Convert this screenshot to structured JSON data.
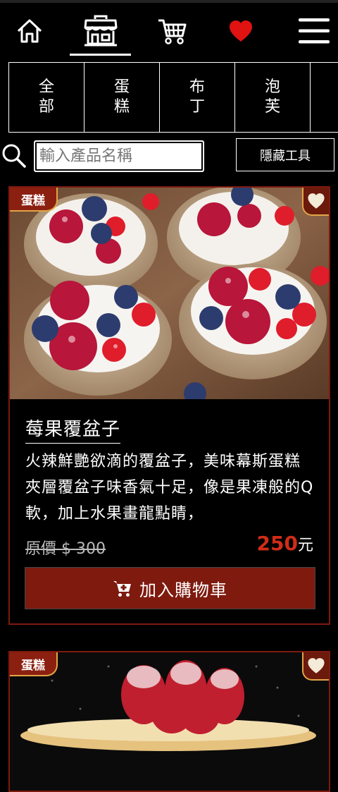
{
  "nav": {
    "items": [
      {
        "name": "home",
        "icon": "home-icon"
      },
      {
        "name": "shop",
        "icon": "store-icon",
        "active": true
      },
      {
        "name": "cart",
        "icon": "cart-icon"
      },
      {
        "name": "favorites",
        "icon": "heart-icon"
      },
      {
        "name": "menu",
        "icon": "hamburger-icon"
      }
    ]
  },
  "categories": [
    "全部",
    "蛋糕",
    "布丁",
    "泡芙",
    ""
  ],
  "tools": {
    "search_placeholder": "輸入產品名稱",
    "hide_label": "隱藏工具"
  },
  "products": [
    {
      "badge": "蛋糕",
      "title": "莓果覆盆子",
      "description": "火辣鮮艷欲滴的覆盆子，美味幕斯蛋糕夾層覆盆子味香氣十足，像是果凍般的Q軟，加上水果畫龍點睛，",
      "old_price": "原價 $ 300",
      "price": "250",
      "currency": "元",
      "add_to_cart": "加入購物車"
    },
    {
      "badge": "蛋糕"
    }
  ],
  "colors": {
    "accent": "#7e1a0e",
    "price": "#d12c17",
    "badge_border": "#e3a545",
    "heart_nav": "#e11212"
  }
}
